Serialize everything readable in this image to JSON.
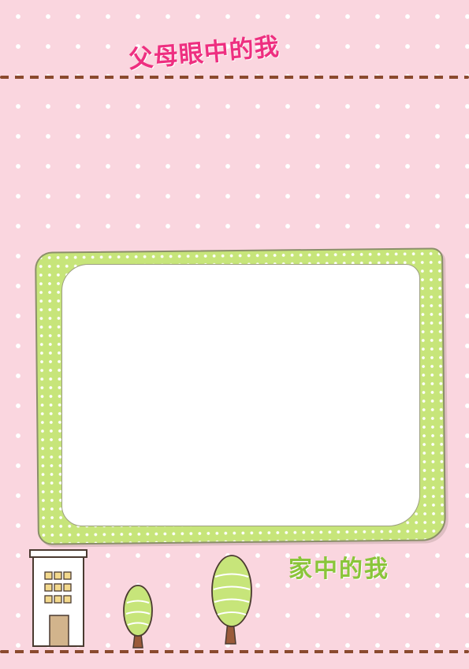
{
  "top_title": "父母眼中的我",
  "bottom_title": "家中的我",
  "colors": {
    "background": "#fad6df",
    "frame": "#c7e57a",
    "top_title": "#ee2f80",
    "bottom_title": "#8ac53a",
    "stitch": "#8a4a2e"
  },
  "icons": [
    "building-icon",
    "tree-icon"
  ]
}
